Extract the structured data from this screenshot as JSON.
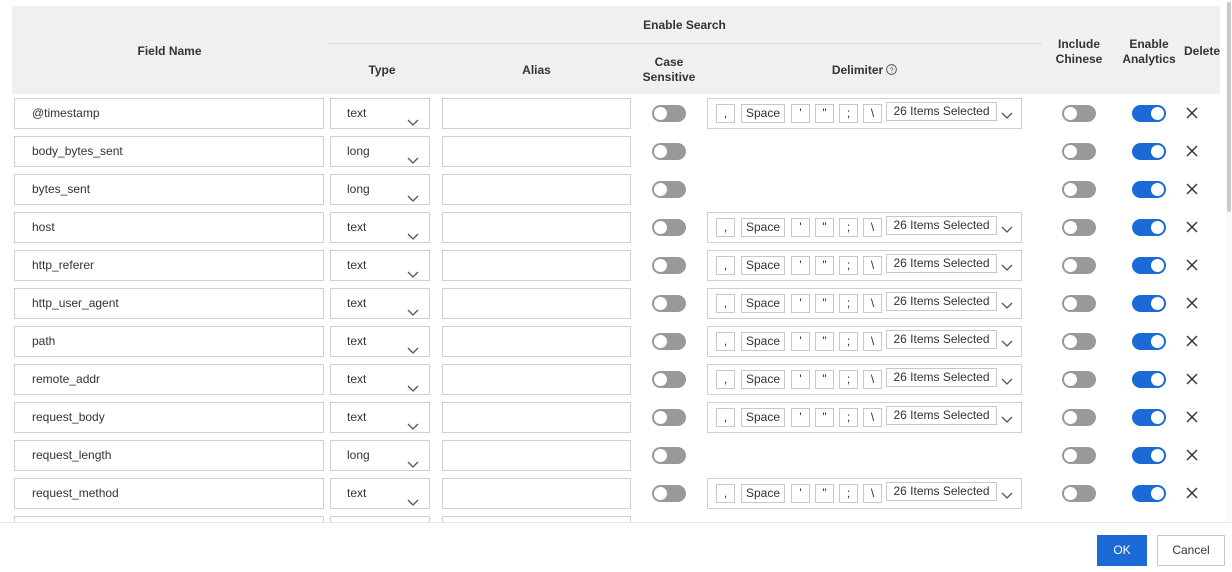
{
  "header": {
    "field_name": "Field Name",
    "enable_search": "Enable Search",
    "type": "Type",
    "alias": "Alias",
    "case_sensitive_1": "Case",
    "case_sensitive_2": "Sensitive",
    "delimiter": "Delimiter",
    "include_chinese_1": "Include",
    "include_chinese_2": "Chinese",
    "enable_analytics_1": "Enable",
    "enable_analytics_2": "Analytics",
    "delete": "Delete"
  },
  "delimiter_tags": [
    ",",
    "Space",
    "'",
    "\"",
    ";",
    "\\"
  ],
  "delimiter_selected": "26 Items Selected",
  "rows": [
    {
      "field": "@timestamp",
      "type": "text",
      "alias": "",
      "case_sensitive": false,
      "show_delimiter": true,
      "include_chinese": false,
      "enable_analytics": true
    },
    {
      "field": "body_bytes_sent",
      "type": "long",
      "alias": "",
      "case_sensitive": false,
      "show_delimiter": false,
      "include_chinese": false,
      "enable_analytics": true
    },
    {
      "field": "bytes_sent",
      "type": "long",
      "alias": "",
      "case_sensitive": false,
      "show_delimiter": false,
      "include_chinese": false,
      "enable_analytics": true
    },
    {
      "field": "host",
      "type": "text",
      "alias": "",
      "case_sensitive": false,
      "show_delimiter": true,
      "include_chinese": false,
      "enable_analytics": true
    },
    {
      "field": "http_referer",
      "type": "text",
      "alias": "",
      "case_sensitive": false,
      "show_delimiter": true,
      "include_chinese": false,
      "enable_analytics": true
    },
    {
      "field": "http_user_agent",
      "type": "text",
      "alias": "",
      "case_sensitive": false,
      "show_delimiter": true,
      "include_chinese": false,
      "enable_analytics": true
    },
    {
      "field": "path",
      "type": "text",
      "alias": "",
      "case_sensitive": false,
      "show_delimiter": true,
      "include_chinese": false,
      "enable_analytics": true
    },
    {
      "field": "remote_addr",
      "type": "text",
      "alias": "",
      "case_sensitive": false,
      "show_delimiter": true,
      "include_chinese": false,
      "enable_analytics": true
    },
    {
      "field": "request_body",
      "type": "text",
      "alias": "",
      "case_sensitive": false,
      "show_delimiter": true,
      "include_chinese": false,
      "enable_analytics": true
    },
    {
      "field": "request_length",
      "type": "long",
      "alias": "",
      "case_sensitive": false,
      "show_delimiter": false,
      "include_chinese": false,
      "enable_analytics": true
    },
    {
      "field": "request_method",
      "type": "text",
      "alias": "",
      "case_sensitive": false,
      "show_delimiter": true,
      "include_chinese": false,
      "enable_analytics": true
    }
  ],
  "footer": {
    "ok_label": "OK",
    "cancel_label": "Cancel"
  },
  "colors": {
    "accent": "#1c6ad5",
    "toggle_off": "#999999",
    "header_bg": "#f0f0f0"
  }
}
